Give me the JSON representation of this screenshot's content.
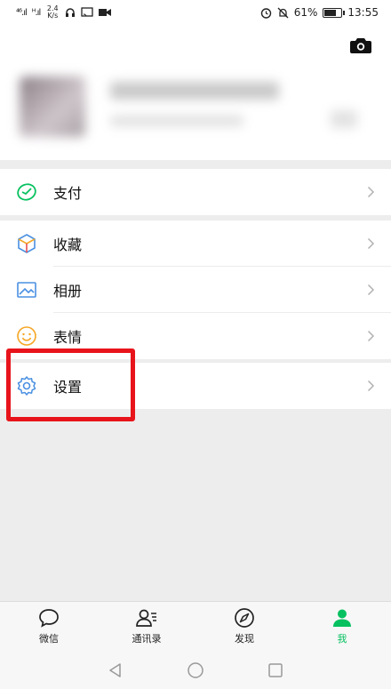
{
  "status_bar": {
    "signal_left": "⁴⁶.ıl",
    "signal_right": "ᴴ.ıl",
    "net_speed_value": "2.4",
    "net_speed_unit": "K/s",
    "battery_percent": "61%",
    "time": "13:55"
  },
  "menu": {
    "pay": "支付",
    "favorites": "收藏",
    "album": "相册",
    "stickers": "表情",
    "settings": "设置"
  },
  "tabs": [
    {
      "label": "微信"
    },
    {
      "label": "通讯录"
    },
    {
      "label": "发现"
    },
    {
      "label": "我"
    }
  ],
  "colors": {
    "accent": "#07c160",
    "highlight": "#e8141b",
    "icon_blue": "#4a90e2",
    "icon_orange": "#f5a623"
  }
}
